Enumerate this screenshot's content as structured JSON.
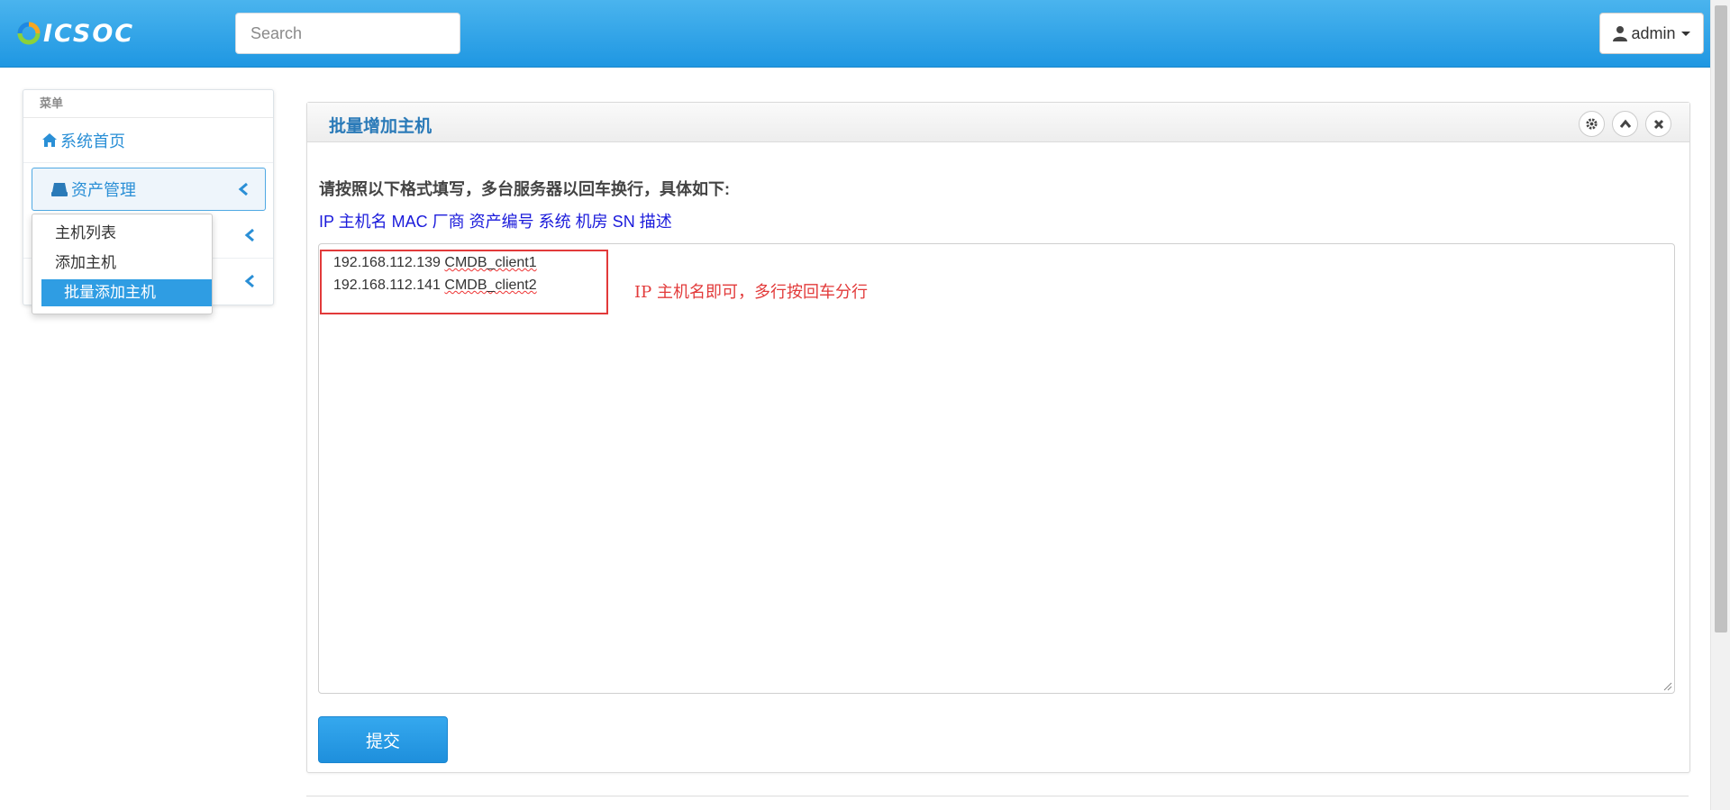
{
  "header": {
    "logo_text": "ICSOC",
    "search_placeholder": "Search",
    "user_label": "admin"
  },
  "sidebar": {
    "header": "菜单",
    "items": [
      {
        "label": "系统首页",
        "icon": "home-icon"
      },
      {
        "label": "资产管理",
        "icon": "hdd-icon"
      }
    ],
    "submenu": [
      "主机列表",
      "添加主机",
      "批量添加主机"
    ]
  },
  "panel": {
    "title": "批量增加主机",
    "instructions": "请按照以下格式填写，多台服务器以回车换行，具体如下:",
    "fields_line": "IP 主机名 MAC 厂商 资产编号 系统 机房 SN 描述",
    "textarea_lines": [
      {
        "ip": "192.168.112.139",
        "host": "CMDB_client1"
      },
      {
        "ip": "192.168.112.141",
        "host": "CMDB_client2"
      }
    ],
    "annotation": "IP 主机名即可，多行按回车分行",
    "submit_label": "提交"
  },
  "colors": {
    "navbar": "#2fa5ea",
    "accent": "#2a8fd6",
    "annotation": "#e23a3a",
    "fields_text": "#1a1adb"
  }
}
